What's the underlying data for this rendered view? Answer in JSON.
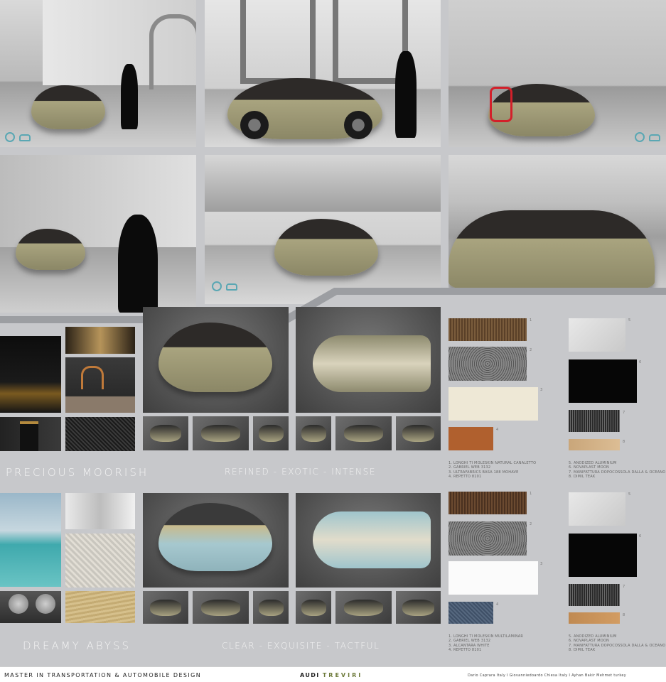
{
  "board": {
    "sections": [
      {
        "name": "PRECIOUS MOORISH",
        "keywords": "REFINED - EXOTIC - INTENSE",
        "materials_left": "1. LONGHI TI MOLESKIN NATURAL CANALETTO\n2. GABRIEL WEB 3132\n3. ULTRAFABRICS BASA 188 MOHAVE\n4. REPETTO 8101",
        "materials_right": "5. ANODIZED ALUMINIUM\n6. NOVAPLAST MOON\n7. MANIFATTURA DOPOCOSSOLA DALLA & OCEANO 4U\n8. DIMIL TEAK",
        "swatch_numbers": [
          "1",
          "2",
          "3",
          "4",
          "5",
          "6",
          "7",
          "8"
        ]
      },
      {
        "name": "DREAMY ABYSS",
        "keywords": "CLEAR - EXQUISITE - TACTFUL",
        "materials_left": "1. LONGHI TI MOLESKIN MULTILAMINAR\n2. GABRIEL WEB 3132\n3. ALCANTARA WHITE\n4. REPETTO 8101",
        "materials_right": "5. ANODIZED ALUMINIUM\n6. NOVAPLAST MOON\n7. MANIFATTURA DOPOCOSSOLA DALLA & OCEANO 4U\n8. DIMIL TEAK",
        "swatch_numbers": [
          "1",
          "2",
          "3",
          "4",
          "5",
          "6",
          "7",
          "8"
        ]
      }
    ],
    "footer": {
      "course": "MASTER IN TRANSPORTATION & AUTOMOBILE DESIGN",
      "project_prefix": "AUDI ",
      "project_name": "TREVIRI",
      "authors": "Dario Caprara Italy  I  Giovanniedoardo Chiesa Italy  I  Ayhan Bakir Mehmet turkey"
    },
    "icons": [
      "steering-wheel-icon",
      "car-icon"
    ],
    "colors": {
      "background": "#c7c8cb",
      "accent": "#5aa7b3",
      "title_text": "#f4f4f4",
      "project_green": "#6d7a3a"
    }
  }
}
